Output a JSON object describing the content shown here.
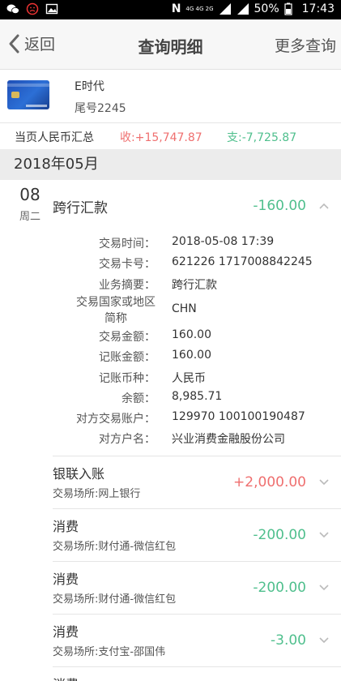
{
  "status_bar": {
    "network": "4G 4G 2G",
    "battery": "50%",
    "time": "17:43"
  },
  "nav": {
    "back_label": "返回",
    "title": "查询明细",
    "more_label": "更多查询"
  },
  "card": {
    "name": "E时代",
    "tail": "尾号2245"
  },
  "summary": {
    "label": "当页人民币汇总",
    "income": "收:+15,747.87",
    "expense": "支:-7,725.87"
  },
  "month": "2018年05月",
  "day": {
    "date": "08",
    "weekday": "周二"
  },
  "expanded_tx": {
    "title": "跨行汇款",
    "amount": "-160.00",
    "details": [
      {
        "label": "交易时间：",
        "value": "2018-05-08 17:39"
      },
      {
        "label": "交易卡号：",
        "value": "621226 1717008842245"
      },
      {
        "label": "业务摘要：",
        "value": "跨行汇款"
      },
      {
        "label": "交易国家或地区\n简称",
        "value": "CHN"
      },
      {
        "label": "交易金额：",
        "value": "160.00"
      },
      {
        "label": "记账金额：",
        "value": "160.00"
      },
      {
        "label": "记账币种：",
        "value": "人民币"
      },
      {
        "label": "余额：",
        "value": "8,985.71"
      },
      {
        "label": "对方交易账户：",
        "value": "129970 100100190487"
      },
      {
        "label": "对方户名：",
        "value": "兴业消费金融股份公司"
      }
    ]
  },
  "transactions": [
    {
      "title": "银联入账",
      "subtitle": "交易场所:网上银行",
      "amount": "+2,000.00",
      "type": "income"
    },
    {
      "title": "消费",
      "subtitle": "交易场所:财付通-微信红包",
      "amount": "-200.00",
      "type": "expense"
    },
    {
      "title": "消费",
      "subtitle": "交易场所:财付通-微信红包",
      "amount": "-200.00",
      "type": "expense"
    },
    {
      "title": "消费",
      "subtitle": "交易场所:支付宝-邵国伟",
      "amount": "-3.00",
      "type": "expense"
    },
    {
      "title": "消费",
      "subtitle": "",
      "amount": "",
      "type": "expense"
    }
  ],
  "colors": {
    "income": "#ef6f6f",
    "expense": "#4fbf8d"
  }
}
